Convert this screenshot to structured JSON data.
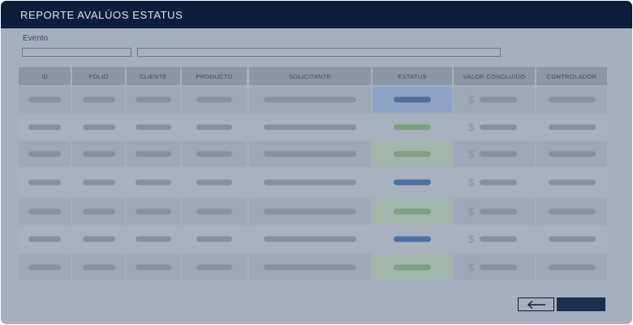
{
  "window": {
    "title": "REPORTE AVALÚOS ESTATUS"
  },
  "filter": {
    "label": "Evento",
    "field_a_value": "",
    "field_b_value": ""
  },
  "table": {
    "columns": [
      "ID",
      "FOLIO",
      "CLIENTE",
      "PRODUCTO",
      "SOLICITANTE",
      "ESTATUS",
      "VALOR CONCLUIDO",
      "CONTROLADOR"
    ],
    "rows": [
      {
        "status": "blue"
      },
      {
        "status": "green"
      },
      {
        "status": "green"
      },
      {
        "status": "blue"
      },
      {
        "status": "green"
      },
      {
        "status": "blue"
      },
      {
        "status": "green"
      }
    ],
    "currency_symbol": "$"
  },
  "footer": {
    "back_icon": "arrow-left-icon"
  },
  "colors": {
    "titlebar": "#0c1e3a",
    "status_blue": "#4f6f9f",
    "status_green": "#7f9f80"
  }
}
